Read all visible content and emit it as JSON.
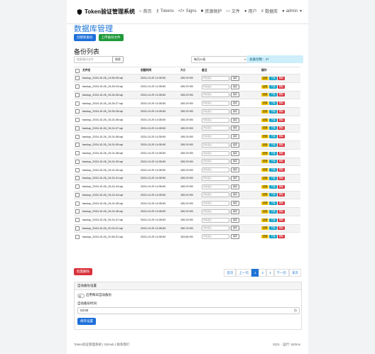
{
  "nav": {
    "brand": "Token验证管理系统",
    "items": [
      "首页",
      "Tokens",
      "Signs",
      "资源保护",
      "文件",
      "用户",
      "数据库",
      "admin"
    ]
  },
  "title": "数据库管理",
  "buttons": {
    "create_backup": "创建新备份",
    "upload_backup": "上传备份文件",
    "search_btn": "搜索",
    "bulk_delete": "批量删除",
    "save_config": "保存设置"
  },
  "backup_list_title": "备份列表",
  "search_placeholder": "搜索备份文件",
  "per_page": "每页20条",
  "total": "总备份数：47",
  "table": {
    "headers": [
      "",
      "文件名",
      "创建时间",
      "大小",
      "备注",
      "操作"
    ],
    "note_placeholder": "添加备注",
    "save_label": "保存",
    "actions": [
      "还原",
      "下载",
      "删除"
    ],
    "rows": [
      {
        "name": "backup_2024-10-26_14-56-09.sql",
        "time": "2024-10-29 14:35:50",
        "size": "155.29 KB"
      },
      {
        "name": "backup_2024-10-26_15-26-23.sql",
        "time": "2024-10-29 14:35:50",
        "size": "155.29 KB"
      },
      {
        "name": "backup_2024-10-26_15-26-26.sql",
        "time": "2024-10-29 14:35:50",
        "size": "155.29 KB"
      },
      {
        "name": "backup_2024-10-26_15-26-27.sql",
        "time": "2024-10-29 14:35:50",
        "size": "155.29 KB"
      },
      {
        "name": "backup_2024-10-26_15-26-28.sql",
        "time": "2024-10-29 14:35:50",
        "size": "155.29 KB"
      },
      {
        "name": "backup_2024-10-26_15-24-06.sql",
        "time": "2024-10-29 14:35:50",
        "size": "155.29 KB"
      },
      {
        "name": "backup_2024-10-26_15-24-07.sql",
        "time": "2024-10-29 14:35:50",
        "size": "155.29 KB"
      },
      {
        "name": "backup_2024-10-26_15-24-08.sql",
        "time": "2024-10-29 14:35:50",
        "size": "155.29 KB"
      },
      {
        "name": "backup_2024-10-26_15-24-09.sql",
        "time": "2024-10-29 14:35:50",
        "size": "155.29 KB"
      },
      {
        "name": "backup_2024-10-26_15-24-38.sql",
        "time": "2024-10-29 14:35:50",
        "size": "155.29 KB"
      },
      {
        "name": "backup_2024-10-26_15-24-39.sql",
        "time": "2024-10-29 14:35:50",
        "size": "155.29 KB"
      },
      {
        "name": "backup_2024-10-26_15-24-40.sql",
        "time": "2024-10-29 14:35:50",
        "size": "155.29 KB"
      },
      {
        "name": "backup_2024-10-26_15-24-41.sql",
        "time": "2024-10-29 14:35:50",
        "size": "155.29 KB"
      },
      {
        "name": "backup_2024-10-26_15-24-43.sql",
        "time": "2024-10-29 14:35:50",
        "size": "155.29 KB"
      },
      {
        "name": "backup_2024-10-26_15-24-44.sql",
        "time": "2024-10-29 14:35:50",
        "size": "155.29 KB"
      },
      {
        "name": "backup_2024-10-26_15-24-45.sql",
        "time": "2024-10-29 14:35:50",
        "size": "155.29 KB"
      },
      {
        "name": "backup_2024-10-26_15-24-46.sql",
        "time": "2024-10-29 14:35:50",
        "size": "155.29 KB"
      },
      {
        "name": "backup_2024-10-26_15-24-47.sql",
        "time": "2024-10-29 14:35:50",
        "size": "155.29 KB"
      },
      {
        "name": "backup_2024-10-26_22-00-21.sql",
        "time": "2024-10-29 14:35:50",
        "size": "156.76 KB"
      },
      {
        "name": "backup_2024-10-26_22-56-31.sql",
        "time": "2024-10-29 14:35:50",
        "size": "153.86 KB"
      }
    ]
  },
  "pager": [
    "首页",
    "上一页",
    "1",
    "2",
    "3",
    "下一页",
    "末页"
  ],
  "auto_backup": {
    "header": "自动备份设置",
    "toggle_label": "启用每日自动备份",
    "time_label": "自动备份时间",
    "time_value": "03:00"
  },
  "footer": {
    "left": "Token验证管理系统 | GitHub | 联系我们",
    "right": "2021 · 运行: 520ms"
  },
  "colors": {
    "primary": "#1e74d6",
    "success": "#1f9a3a",
    "danger": "#d9323b",
    "warning": "#f2c200",
    "info": "#17a2c8"
  }
}
